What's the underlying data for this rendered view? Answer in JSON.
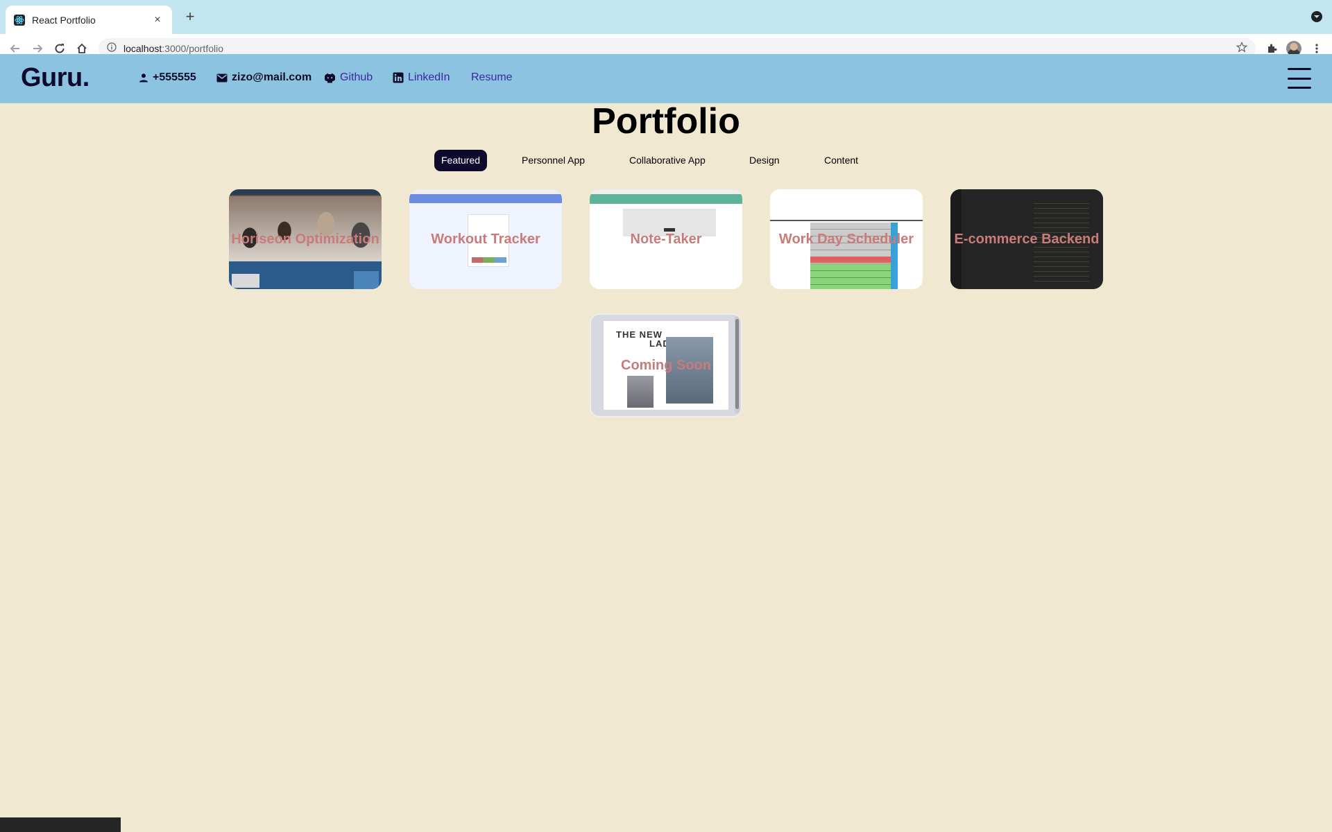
{
  "browser": {
    "tab_title": "React Portfolio",
    "close_label": "×",
    "new_tab_label": "+",
    "url_host": "localhost",
    "url_path": ":3000/portfolio"
  },
  "header": {
    "logo": "Guru.",
    "phone": "+555555",
    "email": "zizo@mail.com",
    "github": "Github",
    "linkedin": "LinkedIn",
    "resume": "Resume"
  },
  "portfolio": {
    "title": "Portfolio",
    "filters": [
      "Featured",
      "Personnel App",
      "Collaborative App",
      "Design",
      "Content"
    ],
    "active_filter": "Featured",
    "projects": [
      {
        "title": "Horiseon Optimization"
      },
      {
        "title": "Workout Tracker"
      },
      {
        "title": "Note-Taker"
      },
      {
        "title": "Work Day Scheduler"
      },
      {
        "title": "E-commerce Backend"
      },
      {
        "title": "Coming Soon"
      }
    ],
    "coming_soon_headline_1": "THE NEW",
    "coming_soon_headline_2": "LADY"
  },
  "colors": {
    "header_bg": "#8cc3e0",
    "page_bg": "#f0e8d0",
    "brand_dark": "#0d0a2e",
    "link": "#3a2a9e",
    "card_title": "#c97b7b"
  }
}
